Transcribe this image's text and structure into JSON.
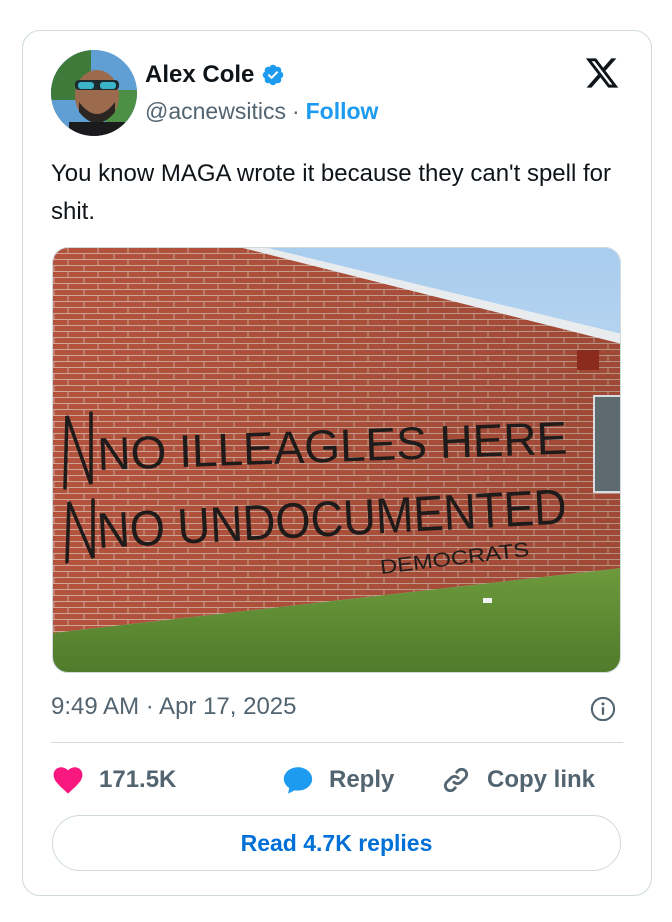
{
  "author": {
    "name": "Alex Cole",
    "handle": "@acnewsitics",
    "separator": "·",
    "follow_label": "Follow"
  },
  "tweet": {
    "text": "You know MAGA wrote it because they can't spell for shit.",
    "timestamp": "9:49 AM · Apr 17, 2025",
    "graffiti": {
      "line1": "NO ILLEAGLES HERE",
      "line2": "NO UNDOCUMENTED",
      "line3": "DEMOCRATS"
    }
  },
  "actions": {
    "likes": "171.5K",
    "reply_label": "Reply",
    "copy_label": "Copy link"
  },
  "read_replies_label": "Read 4.7K replies",
  "colors": {
    "accent": "#1d9bf0",
    "link_blue": "#006fd6",
    "like_pink": "#f91880",
    "muted": "#536471",
    "border": "#cfd9de"
  },
  "icons": [
    "verified-badge-icon",
    "x-logo-icon",
    "info-icon",
    "heart-icon",
    "reply-bubble-icon",
    "link-icon"
  ]
}
